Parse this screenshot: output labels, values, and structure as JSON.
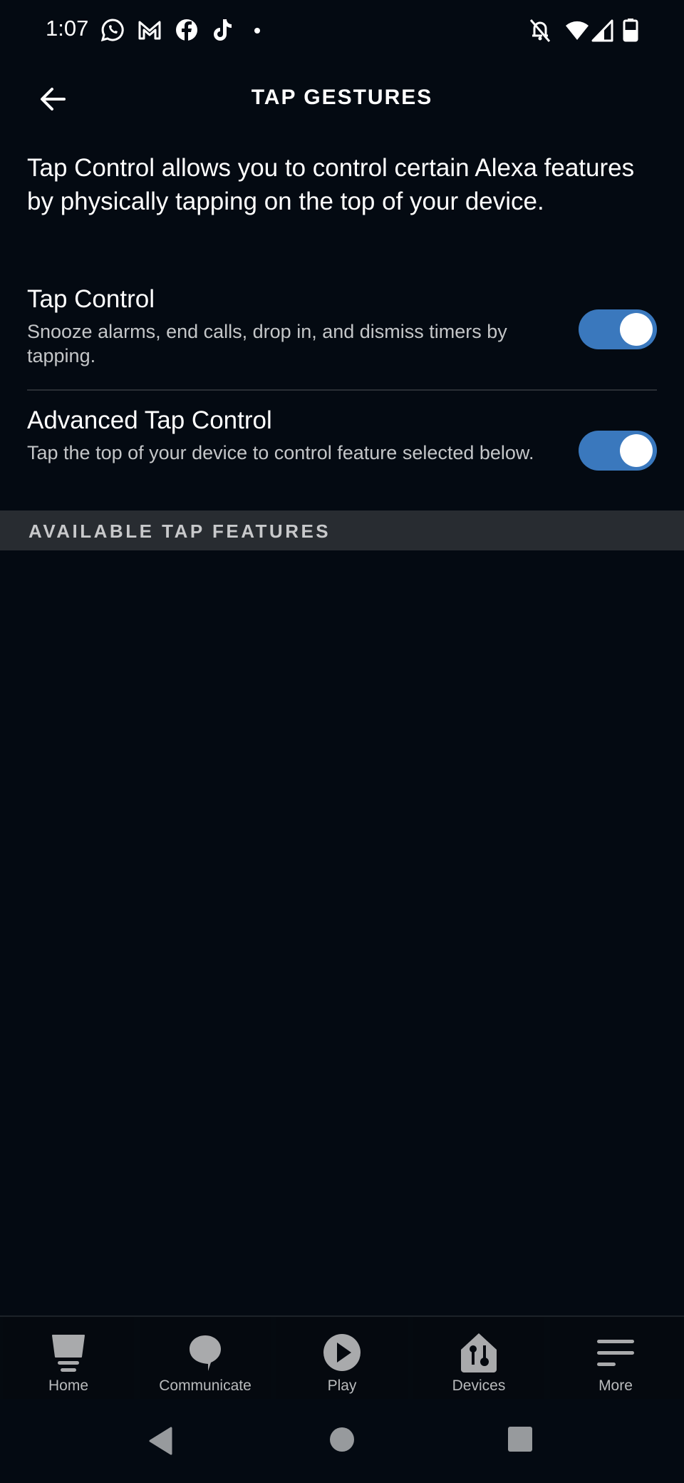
{
  "status_bar": {
    "time": "1:07",
    "notification_icons": [
      "whatsapp-icon",
      "gmail-icon",
      "facebook-icon",
      "tiktok-icon",
      "more-dot-icon"
    ],
    "system_icons": [
      "alarm-off-icon",
      "wifi-icon",
      "cell-signal-icon",
      "battery-icon"
    ]
  },
  "header": {
    "back_icon": "arrow-left-icon",
    "title": "TAP GESTURES"
  },
  "intro_text": "Tap Control allows you to control certain Alexa features by physically tapping on the top of your device.",
  "settings": [
    {
      "name": "Tap Control",
      "description": "Snooze alarms, end calls, drop in, and dismiss timers by tapping.",
      "enabled": true
    },
    {
      "name": "Advanced Tap Control",
      "description": "Tap the top of your device to control feature selected below.",
      "enabled": true
    }
  ],
  "section_header": "AVAILABLE TAP FEATURES",
  "colors": {
    "toggle_on": "#3a78bd",
    "background": "#040a12",
    "section_bg": "#282c31"
  },
  "bottom_nav": {
    "items": [
      {
        "label": "Home",
        "icon": "home-icon"
      },
      {
        "label": "Communicate",
        "icon": "chat-bubble-icon"
      },
      {
        "label": "Play",
        "icon": "play-icon"
      },
      {
        "label": "Devices",
        "icon": "devices-icon"
      },
      {
        "label": "More",
        "icon": "menu-icon"
      }
    ]
  },
  "system_nav": [
    "back-triangle-icon",
    "home-circle-icon",
    "recents-square-icon"
  ]
}
